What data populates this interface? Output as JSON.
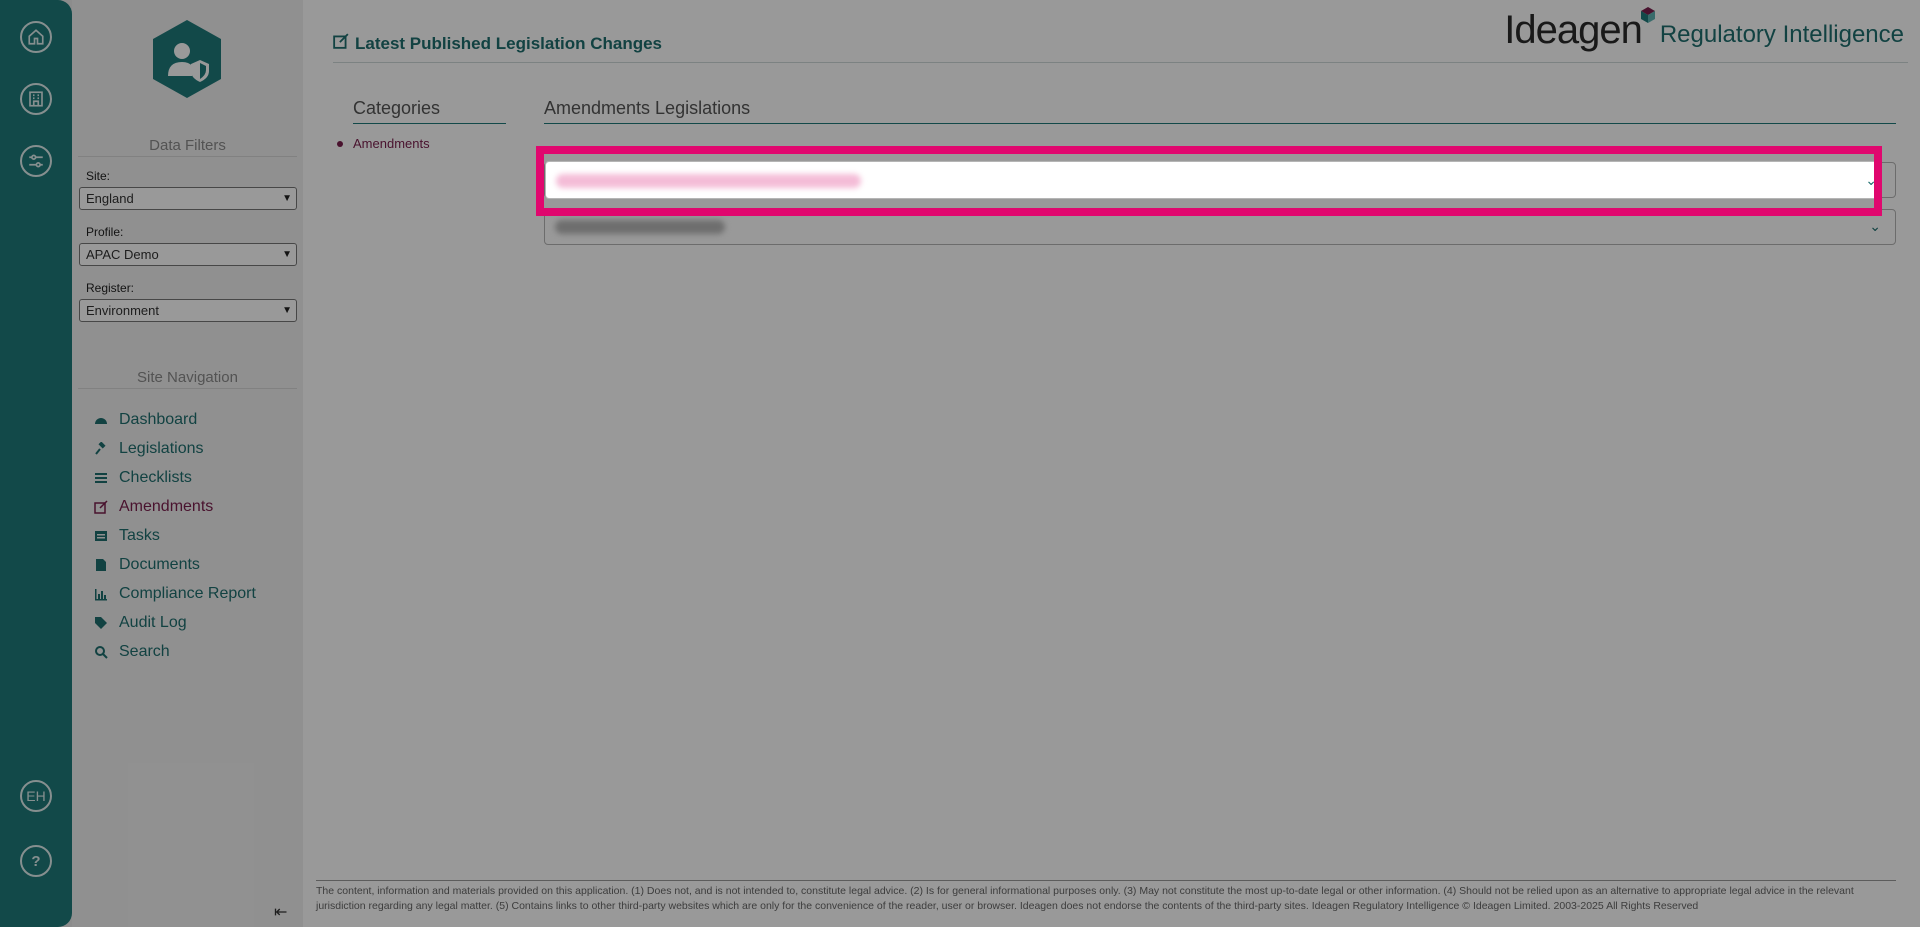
{
  "app": {
    "brand_name": "Ideagen",
    "brand_product": "Regulatory Intelligence",
    "page_title": "Latest Published Legislation Changes"
  },
  "rail": {
    "items": [
      {
        "name": "home-icon"
      },
      {
        "name": "building-icon"
      },
      {
        "name": "sliders-icon"
      }
    ],
    "user_initials": "EH",
    "help_label": "?"
  },
  "sidebar": {
    "data_filters_title": "Data Filters",
    "filters": {
      "site": {
        "label": "Site:",
        "value": "England"
      },
      "profile": {
        "label": "Profile:",
        "value": "APAC Demo"
      },
      "register": {
        "label": "Register:",
        "value": "Environment"
      }
    },
    "site_navigation_title": "Site Navigation",
    "nav": [
      {
        "label": "Dashboard",
        "icon": "dashboard-icon"
      },
      {
        "label": "Legislations",
        "icon": "gavel-icon"
      },
      {
        "label": "Checklists",
        "icon": "list-icon"
      },
      {
        "label": "Amendments",
        "icon": "edit-icon",
        "active": true
      },
      {
        "label": "Tasks",
        "icon": "tasks-icon"
      },
      {
        "label": "Documents",
        "icon": "document-icon"
      },
      {
        "label": "Compliance Report",
        "icon": "chart-icon"
      },
      {
        "label": "Audit Log",
        "icon": "tags-icon"
      },
      {
        "label": "Search",
        "icon": "search-icon"
      }
    ],
    "collapse_glyph": "⇤"
  },
  "main": {
    "categories_title": "Categories",
    "categories": [
      {
        "label": "Amendments"
      }
    ],
    "amendments_title": "Amendments Legislations",
    "dropdowns": [
      {
        "state": "highlighted",
        "text_blurred": true
      },
      {
        "state": "normal",
        "text_blurred": true
      }
    ]
  },
  "footer": {
    "text": "The content, information and materials provided on this application. (1) Does not, and is not intended to, constitute legal advice. (2) Is for general informational purposes only. (3) May not constitute the most up-to-date legal or other information. (4) Should not be relied upon as an alternative to appropriate legal advice in the relevant jurisdiction regarding any legal matter. (5) Contains links to other third-party websites which are only for the convenience of the reader, user or browser. Ideagen does not endorse the contents of the third-party sites. Ideagen Regulatory Intelligence © Ideagen Limited. 2003-2025 All Rights Reserved"
  },
  "colors": {
    "teal": "#1f7a7a",
    "magenta_highlight": "#e0076e",
    "active_nav": "#7a1f4d"
  }
}
